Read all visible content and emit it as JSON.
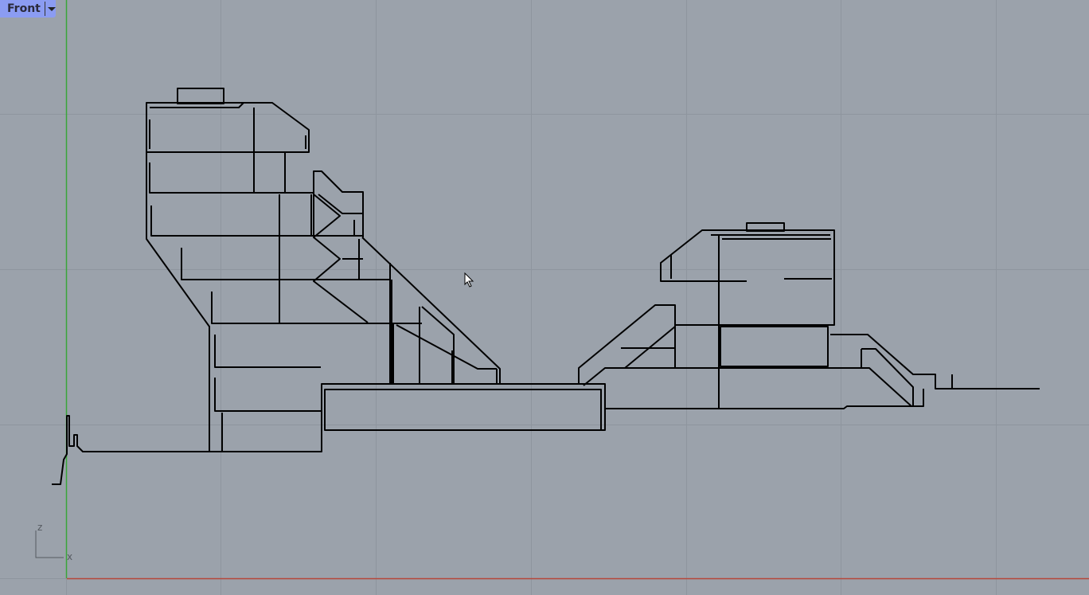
{
  "viewport": {
    "name": "Front",
    "menu_icon": "chevron-down-icon"
  },
  "axis_widget": {
    "z_label": "z",
    "x_label": "x"
  },
  "colors": {
    "background": "#9ba2ab",
    "grid": "#8e959e",
    "x_axis": "#b5473a",
    "z_axis": "#3aa63a",
    "geometry": "#000000",
    "tab": "#8b9cf2"
  }
}
